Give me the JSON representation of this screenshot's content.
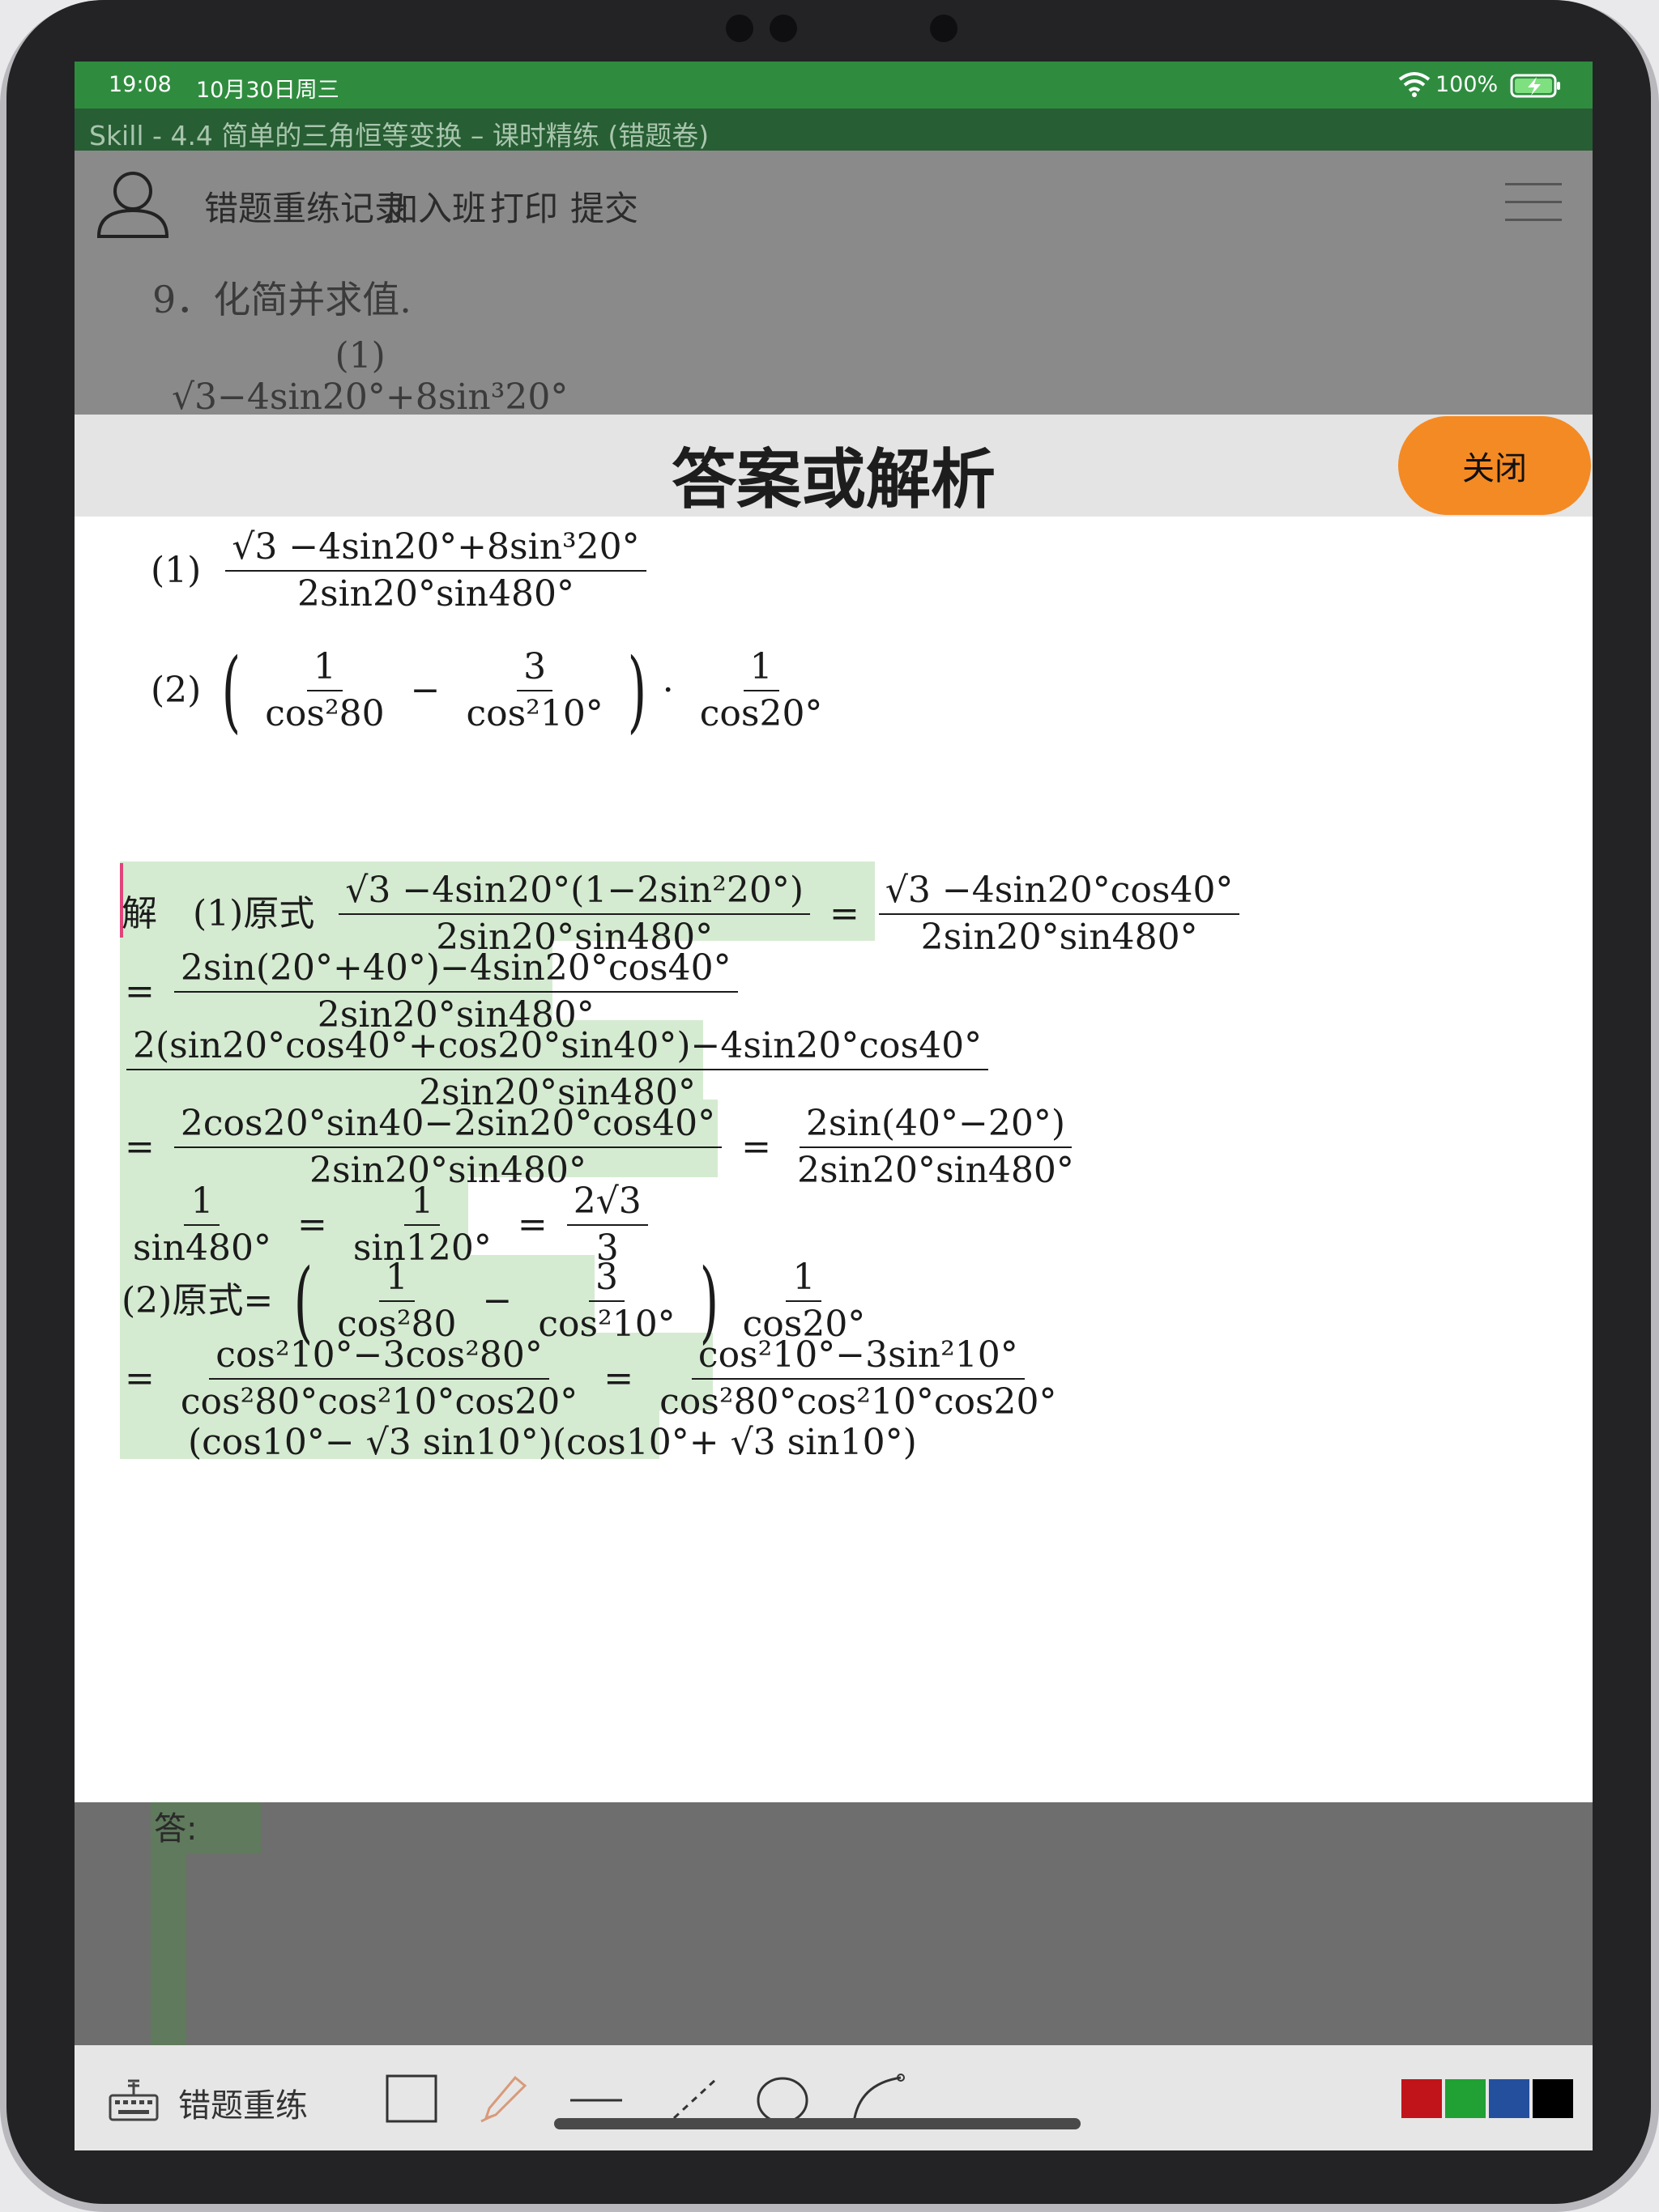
{
  "status": {
    "time": "19:08",
    "date": "10月30日周三",
    "battery": "100%"
  },
  "window_title": "Skill - 4.4 简单的三角恒等变换 – 课时精练 (错题卷)",
  "toolbar": {
    "items": [
      "错题重练记录",
      "加入班",
      "打印",
      "提交"
    ]
  },
  "question": {
    "header": "9．化简并求值.",
    "label1": "(1)",
    "num1": "√3−4sin20°+8sin³20°"
  },
  "modal": {
    "title": "答案或解析",
    "close_label": "关闭"
  },
  "problem": {
    "p1_label": "(1)",
    "p1_num": "√3 −4sin20°+8sin³20°",
    "p1_den": "2sin20°sin480°",
    "p2_label": "(2)",
    "p2_f1_num": "1",
    "p2_f1_den": "cos²80",
    "p2_f2_num": "3",
    "p2_f2_den": "cos²10°",
    "p2_f3_num": "1",
    "p2_f3_den": "cos20°"
  },
  "solution": {
    "head": "解　(1)原式",
    "l1_f1_num": "√3 −4sin20°(1−2sin²20°)",
    "l1_f1_den": "2sin20°sin480°",
    "l1_f2_num": "√3 −4sin20°cos40°",
    "l1_f2_den": "2sin20°sin480°",
    "l2_num": "2sin(20°+40°)−4sin20°cos40°",
    "l2_den": "2sin20°sin480°",
    "l3_num": "2(sin20°cos40°+cos20°sin40°)−4sin20°cos40°",
    "l3_den": "2sin20°sin480°",
    "l4_f1_num": "2cos20°sin40−2sin20°cos40°",
    "l4_f1_den": "2sin20°sin480°",
    "l4_f2_num": "2sin(40°−20°)",
    "l4_f2_den": "2sin20°sin480°",
    "l5_f1_num": "1",
    "l5_f1_den": "sin480°",
    "l5_f2_num": "1",
    "l5_f2_den": "sin120°",
    "l5_f3_num": "2√3",
    "l5_f3_den": "3",
    "l6_head": "(2)原式=",
    "l6_f1_num": "1",
    "l6_f1_den": "cos²80",
    "l6_f2_num": "3",
    "l6_f2_den": "cos²10°",
    "l6_f3_num": "1",
    "l6_f3_den": "cos20°",
    "l7_f1_num": "cos²10°−3cos²80°",
    "l7_f1_den": "cos²80°cos²10°cos20°",
    "l7_f2_num": "cos²10°−3sin²10°",
    "l7_f2_den": "cos²80°cos²10°cos20°",
    "l8_partial": "(cos10°− √3 sin10°)(cos10°+ √3 sin10°)"
  },
  "answer_label": "答:",
  "bottom": {
    "retrain_label": "错题重练"
  },
  "colors": {
    "green": "#2f8c3f",
    "close": "#f48a24",
    "highlight": "#d5ebd1",
    "swatches": [
      "#c0141a",
      "#21a034",
      "#244f9c",
      "#000000"
    ]
  }
}
